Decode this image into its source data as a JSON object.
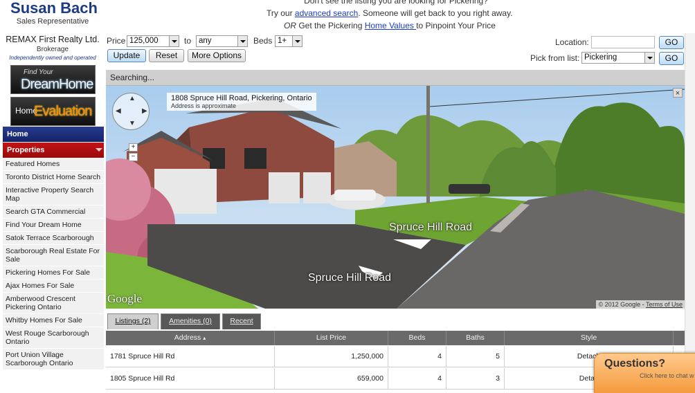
{
  "agent": {
    "name": "Susan Bach",
    "title": "Sales Representative",
    "brokerage": "REMAX First Realty Ltd.",
    "brokerage_label": "Brokerage",
    "brokerage_note": "Independently owned and operated"
  },
  "promos": {
    "dream_small": "Find Your",
    "dream_big": "DreamHome",
    "eval_small": "Home",
    "eval_big": "Evaluation"
  },
  "nav": {
    "home": "Home",
    "properties": "Properties",
    "items": [
      "Featured Homes",
      "Toronto District Home Search",
      "Interactive Property Search Map",
      "Search GTA Commercial",
      "Find Your Dream Home",
      "Satok Terrace Scarborough",
      "Scarborough Real Estate For Sale",
      "Pickering Homes For Sale",
      "Ajax Homes For Sale",
      "Amberwood Crescent Pickering Ontario",
      "Whitby Homes For Sale",
      "West Rouge Scarborough Ontario",
      "Port Union Village Scarborough Ontario"
    ]
  },
  "top": {
    "msg_line1": "Don't see the listing you are looking for Pickering?",
    "line2_pre": "Try our ",
    "line2_link": "advanced search",
    "line2_post": ". Someone will get back to you right away.",
    "line3_or": "OR",
    "line3_pre": " Get the Pickering ",
    "line3_link": "Home Values ",
    "line3_post": "to Pinpoint Your Price"
  },
  "filters": {
    "price_label": "Price",
    "price_value": "125,000",
    "to_label": "to",
    "to_value": "any",
    "beds_label": "Beds",
    "beds_value": "1+",
    "update": "Update",
    "reset": "Reset",
    "more": "More Options",
    "location_label": "Location:",
    "location_value": "",
    "go1": "GO",
    "pick_label": "Pick from list:",
    "pick_value": "Pickering",
    "go2": "GO"
  },
  "streetview": {
    "status": "Searching...",
    "address": "1808 Spruce Hill Road, Pickering, Ontario",
    "approx": "Address is approximate",
    "road_label": "Spruce Hill Road",
    "copyright": "© 2012 Google - ",
    "terms": "Terms of Use",
    "google": "Google",
    "close": "×"
  },
  "tabs": [
    "Listings (2)",
    "Amenities (0)",
    "Recent"
  ],
  "table": {
    "headers": [
      "Address",
      "List Price",
      "Beds",
      "Baths",
      "Style"
    ],
    "rows": [
      {
        "address": "1781 Spruce Hill Rd",
        "price": "1,250,000",
        "beds": "4",
        "baths": "5",
        "style": "Detach"
      },
      {
        "address": "1805 Spruce Hill Rd",
        "price": "659,000",
        "beds": "4",
        "baths": "3",
        "style": "Detac"
      }
    ]
  },
  "questions": {
    "title": "Questions?",
    "sub": "Click here to chat w"
  }
}
